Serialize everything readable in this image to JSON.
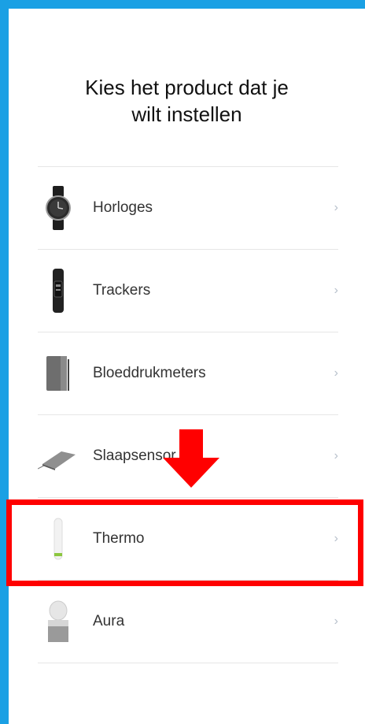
{
  "header": {
    "title_line1": "Kies het product dat je",
    "title_line2": "wilt instellen"
  },
  "products": [
    {
      "label": "Horloges",
      "icon": "watch-icon"
    },
    {
      "label": "Trackers",
      "icon": "tracker-icon"
    },
    {
      "label": "Bloeddrukmeters",
      "icon": "blood-pressure-monitor-icon"
    },
    {
      "label": "Slaapsensor",
      "icon": "sleep-sensor-icon"
    },
    {
      "label": "Thermo",
      "icon": "thermometer-icon"
    },
    {
      "label": "Aura",
      "icon": "aura-lamp-icon"
    }
  ],
  "chevron": "›",
  "colors": {
    "frame": "#1aa0e4",
    "highlight": "#ff0000",
    "arrow": "#ff0000",
    "chevron": "#b7c0cb"
  },
  "annotation": {
    "highlighted_item": "Thermo",
    "arrow": "pointing down at Thermo"
  }
}
